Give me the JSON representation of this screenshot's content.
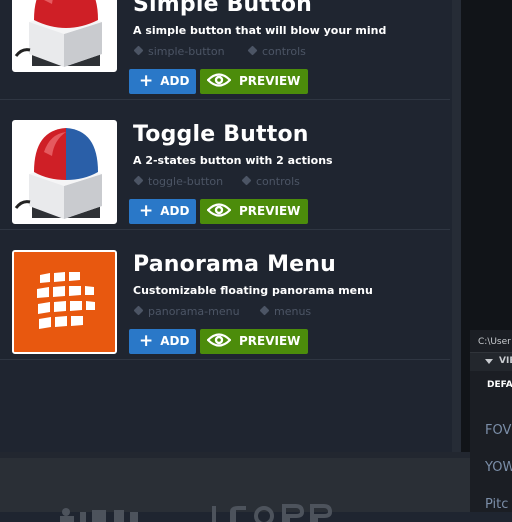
{
  "items": [
    {
      "title": "Simple Button",
      "description": "A simple button that will blow your mind",
      "tags": [
        "simple-button",
        "controls"
      ],
      "add_label": "ADD",
      "preview_label": "PREVIEW",
      "thumbnail": "red-push-button"
    },
    {
      "title": "Toggle Button",
      "description": "A 2-states button with 2 actions",
      "tags": [
        "toggle-button",
        "controls"
      ],
      "add_label": "ADD",
      "preview_label": "PREVIEW",
      "thumbnail": "red-blue-push-button"
    },
    {
      "title": "Panorama Menu",
      "description": "Customizable floating panorama menu",
      "tags": [
        "panorama-menu",
        "menus"
      ],
      "add_label": "ADD",
      "preview_label": "PREVIEW",
      "thumbnail": "orange-grid-tiles"
    }
  ],
  "side_panel": {
    "path": "C:\\User",
    "section": "VIE",
    "default_label": "DEFA",
    "props": [
      "FOV",
      "YOW",
      "Pitc"
    ]
  },
  "colors": {
    "add": "#2a78c8",
    "preview": "#4c8c0b",
    "background": "#1f2530",
    "tag": "#4c5565"
  }
}
